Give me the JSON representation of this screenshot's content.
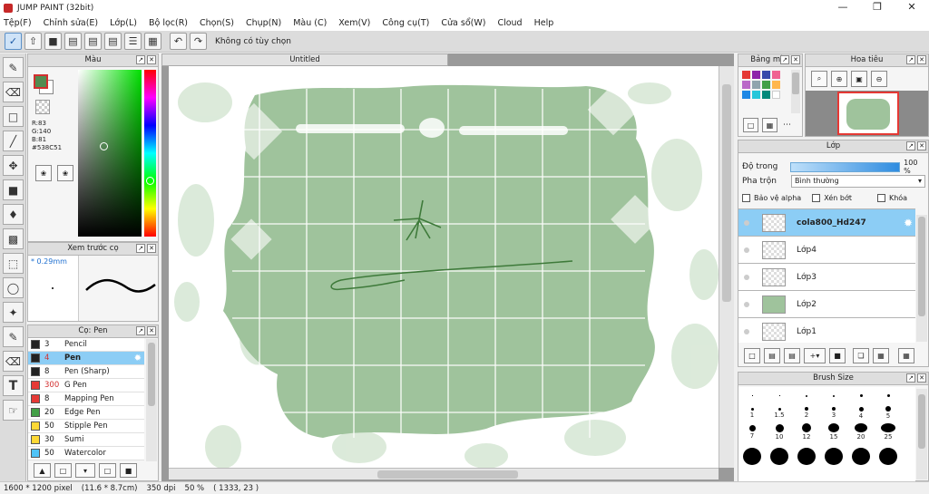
{
  "window": {
    "title": "JUMP PAINT (32bit)"
  },
  "menu": [
    "Tệp(F)",
    "Chỉnh sửa(E)",
    "Lớp(L)",
    "Bộ lọc(R)",
    "Chọn(S)",
    "Chụp(N)",
    "Màu (C)",
    "Xem(V)",
    "Công cụ(T)",
    "Cửa sổ(W)",
    "Cloud",
    "Help"
  ],
  "toolbar": {
    "status": "Không có tùy chọn"
  },
  "color_panel": {
    "title": "Màu",
    "rgb": [
      "R:83",
      "G:140",
      "B:81"
    ],
    "hex": "#538C51",
    "main_color": "#538C51"
  },
  "brush_preview": {
    "title": "Xem trước cọ",
    "size": "* 0.29mm"
  },
  "brush_panel": {
    "title": "Cọ: Pen",
    "items": [
      {
        "size": "3",
        "name": "Pencil",
        "color": "#222222"
      },
      {
        "size": "4",
        "name": "Pen",
        "color": "#222222",
        "selected": true
      },
      {
        "size": "8",
        "name": "Pen (Sharp)",
        "color": "#222222"
      },
      {
        "size": "300",
        "name": "G Pen",
        "color": "#e53935"
      },
      {
        "size": "8",
        "name": "Mapping Pen",
        "color": "#e53935"
      },
      {
        "size": "20",
        "name": "Edge Pen",
        "color": "#43a047"
      },
      {
        "size": "50",
        "name": "Stipple Pen",
        "color": "#fdd835"
      },
      {
        "size": "30",
        "name": "Sumi",
        "color": "#fdd835"
      },
      {
        "size": "50",
        "name": "Watercolor",
        "color": "#4fc3f7"
      }
    ]
  },
  "canvas": {
    "tab": "Untitled"
  },
  "palette": {
    "title": "Bảng màu",
    "colors": [
      "#e53935",
      "#8e24aa",
      "#3949ab",
      "#f06292",
      "#ba68c8",
      "#90a4ae",
      "#43a047",
      "#ffb74d",
      "#1e88e5",
      "#26c6da",
      "#00897b",
      "#ffffff"
    ]
  },
  "navigator": {
    "title": "Hoa tiêu"
  },
  "layers": {
    "title": "Lớp",
    "opacity_label": "Độ trong",
    "opacity_value": "100 %",
    "blend_label": "Pha trộn",
    "blend_value": "Bình thường",
    "protect_alpha": "Bảo vệ alpha",
    "clipping": "Xén bớt",
    "lock": "Khóa",
    "items": [
      {
        "name": "cola800_Hd247",
        "selected": true
      },
      {
        "name": "Lớp4"
      },
      {
        "name": "Lớp3"
      },
      {
        "name": "Lớp2"
      },
      {
        "name": "Lớp1"
      }
    ]
  },
  "brush_size": {
    "title": "Brush Size",
    "rows": [
      [
        "",
        "",
        "",
        "",
        "",
        "",
        ""
      ],
      [
        "1",
        "1.5",
        "2",
        "3",
        "4",
        "5",
        ""
      ],
      [
        "7",
        "10",
        "12",
        "15",
        "20",
        "25",
        ""
      ],
      [
        "",
        "",
        "",
        "",
        "",
        "",
        ""
      ]
    ]
  },
  "status": {
    "pixels": "1600 * 1200 pixel",
    "cm": "(11.6 * 8.7cm)",
    "dpi": "350 dpi",
    "zoom": "50 %",
    "coords": "( 1333, 23 )"
  }
}
